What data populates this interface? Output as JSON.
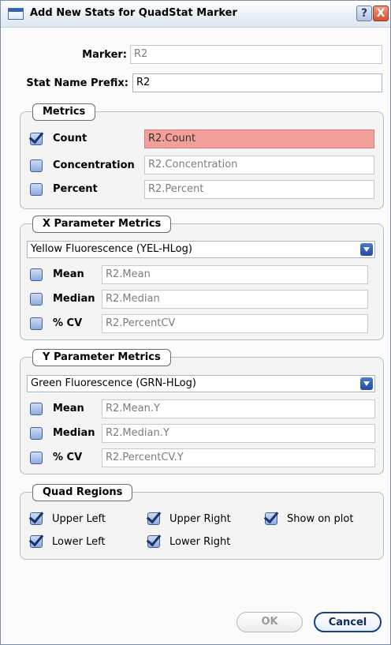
{
  "window": {
    "title": "Add New Stats for QuadStat Marker",
    "help_label": "?",
    "close_label": "X"
  },
  "marker": {
    "label": "Marker:",
    "value": "R2"
  },
  "prefix": {
    "label": "Stat Name Prefix:",
    "value": "R2"
  },
  "metrics": {
    "legend": "Metrics",
    "items": [
      {
        "label": "Count",
        "checked": true,
        "value": "R2.Count"
      },
      {
        "label": "Concentration",
        "checked": false,
        "value": "R2.Concentration"
      },
      {
        "label": "Percent",
        "checked": false,
        "value": "R2.Percent"
      }
    ]
  },
  "x_metrics": {
    "legend": "X Parameter Metrics",
    "selected": "Yellow Fluorescence (YEL-HLog)",
    "items": [
      {
        "label": "Mean",
        "checked": false,
        "value": "R2.Mean"
      },
      {
        "label": "Median",
        "checked": false,
        "value": "R2.Median"
      },
      {
        "label": "% CV",
        "checked": false,
        "value": "R2.PercentCV"
      }
    ]
  },
  "y_metrics": {
    "legend": "Y Parameter Metrics",
    "selected": "Green Fluorescence (GRN-HLog)",
    "items": [
      {
        "label": "Mean",
        "checked": false,
        "value": "R2.Mean.Y"
      },
      {
        "label": "Median",
        "checked": false,
        "value": "R2.Median.Y"
      },
      {
        "label": "% CV",
        "checked": false,
        "value": "R2.PercentCV.Y"
      }
    ]
  },
  "quad": {
    "legend": "Quad Regions",
    "items": [
      {
        "label": "Upper Left",
        "checked": true
      },
      {
        "label": "Upper Right",
        "checked": true
      },
      {
        "label": "Show on plot",
        "checked": true
      },
      {
        "label": "Lower Left",
        "checked": true
      },
      {
        "label": "Lower Right",
        "checked": true
      }
    ]
  },
  "buttons": {
    "ok": "OK",
    "cancel": "Cancel"
  },
  "colors": {
    "error_field": "#f4a09a",
    "checkbox_blue": "#90aade",
    "accent": "#1b3f87"
  }
}
